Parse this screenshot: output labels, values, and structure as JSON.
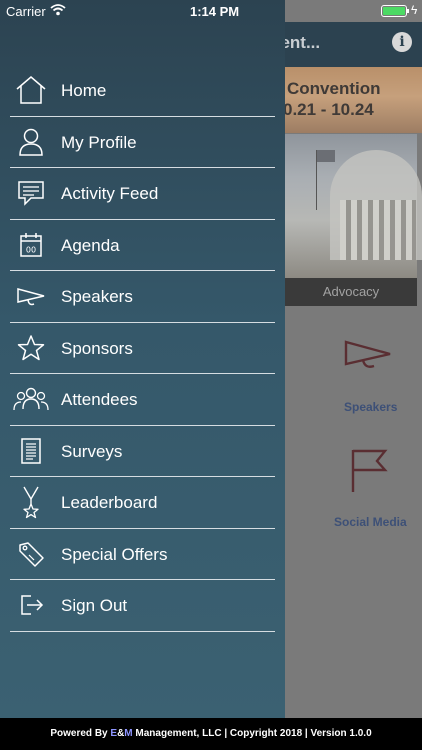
{
  "status_bar": {
    "carrier": "Carrier",
    "time": "1:14 PM"
  },
  "background": {
    "header_title": "vent...",
    "banner_line1": "Convention",
    "banner_line2": "0.21 - 10.24",
    "photo_caption": "Advocacy",
    "tiles": [
      {
        "label": "Speakers",
        "icon": "megaphone-icon"
      },
      {
        "label": "Social Media",
        "icon": "flag-icon"
      }
    ]
  },
  "menu": {
    "items": [
      {
        "label": "Home",
        "icon": "home-icon"
      },
      {
        "label": "My Profile",
        "icon": "profile-icon"
      },
      {
        "label": "Activity Feed",
        "icon": "chat-icon"
      },
      {
        "label": "Agenda",
        "icon": "calendar-icon"
      },
      {
        "label": "Speakers",
        "icon": "megaphone-icon"
      },
      {
        "label": "Sponsors",
        "icon": "star-icon"
      },
      {
        "label": "Attendees",
        "icon": "people-icon"
      },
      {
        "label": "Surveys",
        "icon": "document-icon"
      },
      {
        "label": "Leaderboard",
        "icon": "medal-icon"
      },
      {
        "label": "Special Offers",
        "icon": "tag-icon"
      },
      {
        "label": "Sign Out",
        "icon": "sign-out-icon"
      }
    ]
  },
  "footer": {
    "prefix": "Powered By ",
    "brand_e": "E",
    "brand_amp": "&",
    "brand_m": "M",
    "suffix": " Management, LLC | Copyright 2018 | Version 1.0.0"
  },
  "colors": {
    "drawer": "#35586a",
    "header": "#2c4250",
    "footer": "#000000",
    "brand": "#8f96ff"
  }
}
